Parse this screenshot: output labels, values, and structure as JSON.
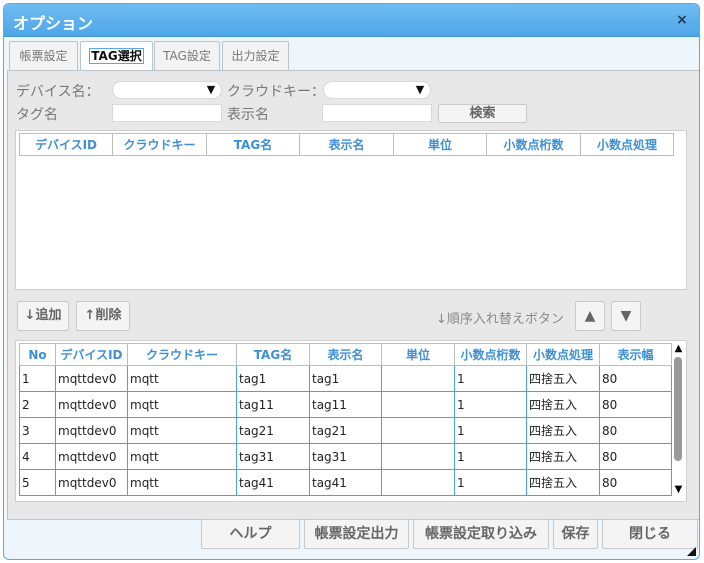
{
  "dialog": {
    "title": "オプション",
    "close": "×"
  },
  "tabs": [
    {
      "label": "帳票設定",
      "active": false
    },
    {
      "label": "TAG選択",
      "active": true
    },
    {
      "label": "TAG設定",
      "active": false
    },
    {
      "label": "出力設定",
      "active": false
    }
  ],
  "filters": {
    "device_label": "デバイス名：",
    "device_value": "",
    "cloud_label": "クラウドキー：",
    "cloud_value": "",
    "tag_label": "タグ名",
    "tag_value": "",
    "display_label": "表示名",
    "display_value": "",
    "search_button": "検索",
    "dropdown_arrow": "▼"
  },
  "search_table": {
    "headers": [
      "デバイスID",
      "クラウドキー",
      "TAG名",
      "表示名",
      "単位",
      "小数点桁数",
      "小数点処理"
    ]
  },
  "actions": {
    "add": "↓追加",
    "delete": "↑削除",
    "order_label": "↓順序入れ替えボタン",
    "up": "▲",
    "down": "▼"
  },
  "selected_table": {
    "headers": [
      "No",
      "デバイスID",
      "クラウドキー",
      "TAG名",
      "表示名",
      "単位",
      "小数点桁数",
      "小数点処理",
      "表示幅"
    ],
    "rows": [
      [
        "1",
        "mqttdev0",
        "mqtt",
        "tag1",
        "tag1",
        "",
        "1",
        "四捨五入",
        "80"
      ],
      [
        "2",
        "mqttdev0",
        "mqtt",
        "tag11",
        "tag11",
        "",
        "1",
        "四捨五入",
        "80"
      ],
      [
        "3",
        "mqttdev0",
        "mqtt",
        "tag21",
        "tag21",
        "",
        "1",
        "四捨五入",
        "80"
      ],
      [
        "4",
        "mqttdev0",
        "mqtt",
        "tag31",
        "tag31",
        "",
        "1",
        "四捨五入",
        "80"
      ],
      [
        "5",
        "mqttdev0",
        "mqtt",
        "tag41",
        "tag41",
        "",
        "1",
        "四捨五入",
        "80"
      ]
    ]
  },
  "footer": {
    "help": "ヘルプ",
    "export": "帳票設定出力",
    "import": "帳票設定取り込み",
    "save": "保存",
    "close": "閉じる"
  }
}
